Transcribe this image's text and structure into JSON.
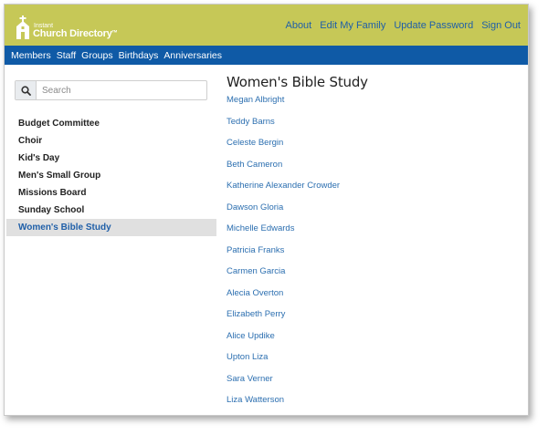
{
  "brand": {
    "instant": "Instant",
    "name": "Church Directory",
    "tm": "TM"
  },
  "top_links": [
    {
      "label": "About"
    },
    {
      "label": "Edit My Family"
    },
    {
      "label": "Update Password"
    },
    {
      "label": "Sign Out"
    }
  ],
  "nav": [
    {
      "label": "Members"
    },
    {
      "label": "Staff"
    },
    {
      "label": "Groups"
    },
    {
      "label": "Birthdays"
    },
    {
      "label": "Anniversaries"
    }
  ],
  "search": {
    "placeholder": "Search",
    "value": ""
  },
  "groups": [
    {
      "label": "Budget Committee"
    },
    {
      "label": "Choir"
    },
    {
      "label": "Kid's Day"
    },
    {
      "label": "Men's Small Group"
    },
    {
      "label": "Missions Board"
    },
    {
      "label": "Sunday School"
    },
    {
      "label": "Women's Bible Study"
    }
  ],
  "active_group_index": 6,
  "main": {
    "title": "Women's Bible Study",
    "members": [
      "Megan Albright",
      "Teddy Barns",
      "Celeste Bergin",
      "Beth Cameron",
      "Katherine Alexander Crowder",
      "Dawson Gloria",
      "Michelle Edwards",
      "Patricia Franks",
      "Carmen Garcia",
      "Alecia Overton",
      "Elizabeth Perry",
      "Alice Updike",
      "Upton Liza",
      "Sara Verner",
      "Liza Watterson"
    ]
  },
  "colors": {
    "header_bg": "#c6c857",
    "nav_bg": "#0f5aa6",
    "link": "#2c6fb0",
    "active_bg": "#e0e0e0"
  },
  "icons": {
    "logo": "church-icon",
    "search": "search-icon"
  }
}
